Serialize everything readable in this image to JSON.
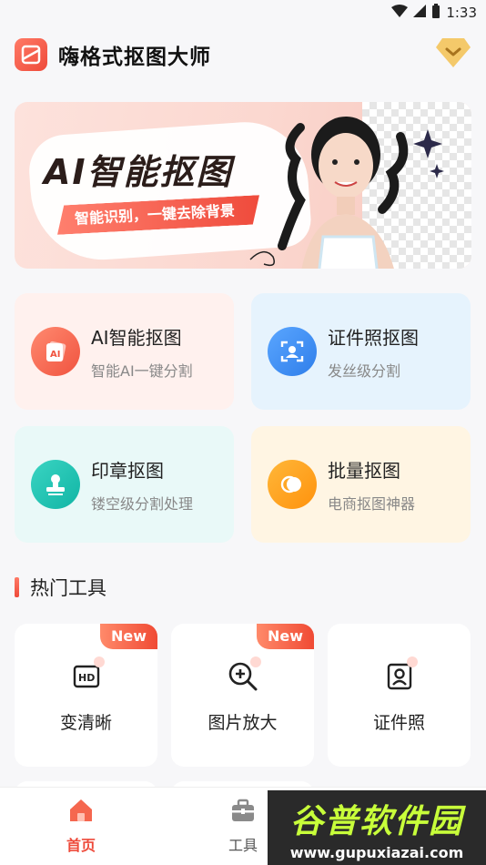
{
  "status_bar": {
    "time": "1:33"
  },
  "header": {
    "app_title": "嗨格式抠图大师"
  },
  "banner": {
    "title": "AI智能抠图",
    "subtitle": "智能识别，一键去除背景"
  },
  "features": [
    {
      "title": "AI智能抠图",
      "subtitle": "智能AI一键分割",
      "icon": "ai-photo-icon",
      "color": "#ff6f59"
    },
    {
      "title": "证件照抠图",
      "subtitle": "发丝级分割",
      "icon": "id-portrait-icon",
      "color": "#3d8ff5"
    },
    {
      "title": "印章抠图",
      "subtitle": "镂空级分割处理",
      "icon": "stamp-icon",
      "color": "#1ec6b5"
    },
    {
      "title": "批量抠图",
      "subtitle": "电商抠图神器",
      "icon": "batch-icon",
      "color": "#ffa319"
    }
  ],
  "hot_tools": {
    "title": "热门工具",
    "items": [
      {
        "label": "变清晰",
        "badge": "New",
        "icon": "hd-icon"
      },
      {
        "label": "图片放大",
        "badge": "New",
        "icon": "zoom-in-icon"
      },
      {
        "label": "证件照",
        "badge": "",
        "icon": "id-photo-icon"
      }
    ]
  },
  "bottom_nav": {
    "items": [
      {
        "label": "首页",
        "icon": "home-icon",
        "active": true
      },
      {
        "label": "工具",
        "icon": "toolbox-icon",
        "active": false
      }
    ]
  },
  "watermark": {
    "main": "谷普软件园",
    "url": "www.gupuxiazai.com"
  },
  "colors": {
    "accent": "#ee4a3a",
    "text": "#222222",
    "subtext": "#888888"
  }
}
